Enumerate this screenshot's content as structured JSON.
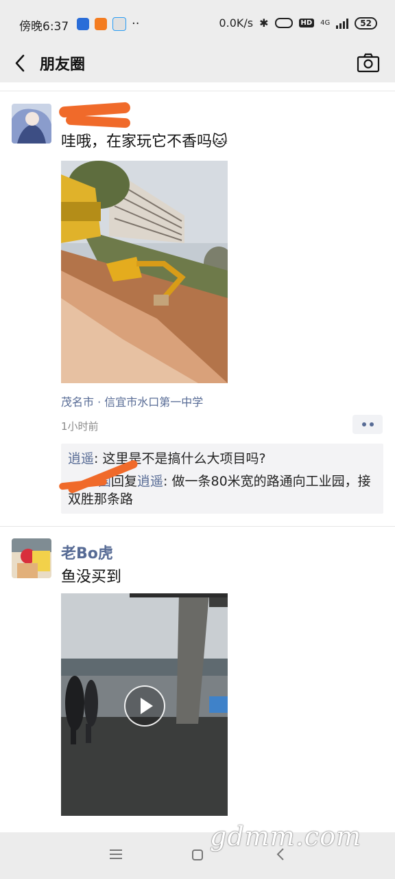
{
  "status_bar": {
    "time": "傍晚6:37",
    "speed": "0.0K/s",
    "network": "4G",
    "battery": "52"
  },
  "nav": {
    "title": "朋友圈"
  },
  "posts": [
    {
      "author": "",
      "text": "哇哦，在家玩它不香吗",
      "emoji": "🐱",
      "location": "茂名市 · 信宜市水口第一中学",
      "time": "1小时前",
      "comments": {
        "c1_name": "逍遥",
        "c1_sep": ": ",
        "c1_text": "这里是不是搞什么大项目吗?",
        "c2_name": "国",
        "c2_reply": "回复",
        "c2_to": "逍遥",
        "c2_text": ": 做一条80米宽的路通向工业园，接双胜那条路"
      }
    },
    {
      "author": "老Bo虎",
      "text": "鱼没买到",
      "media": "video"
    }
  ],
  "watermark": "gdmm.com",
  "colors": {
    "link": "#576b95",
    "bar": "#ededed",
    "comment_bg": "#f3f3f5"
  }
}
